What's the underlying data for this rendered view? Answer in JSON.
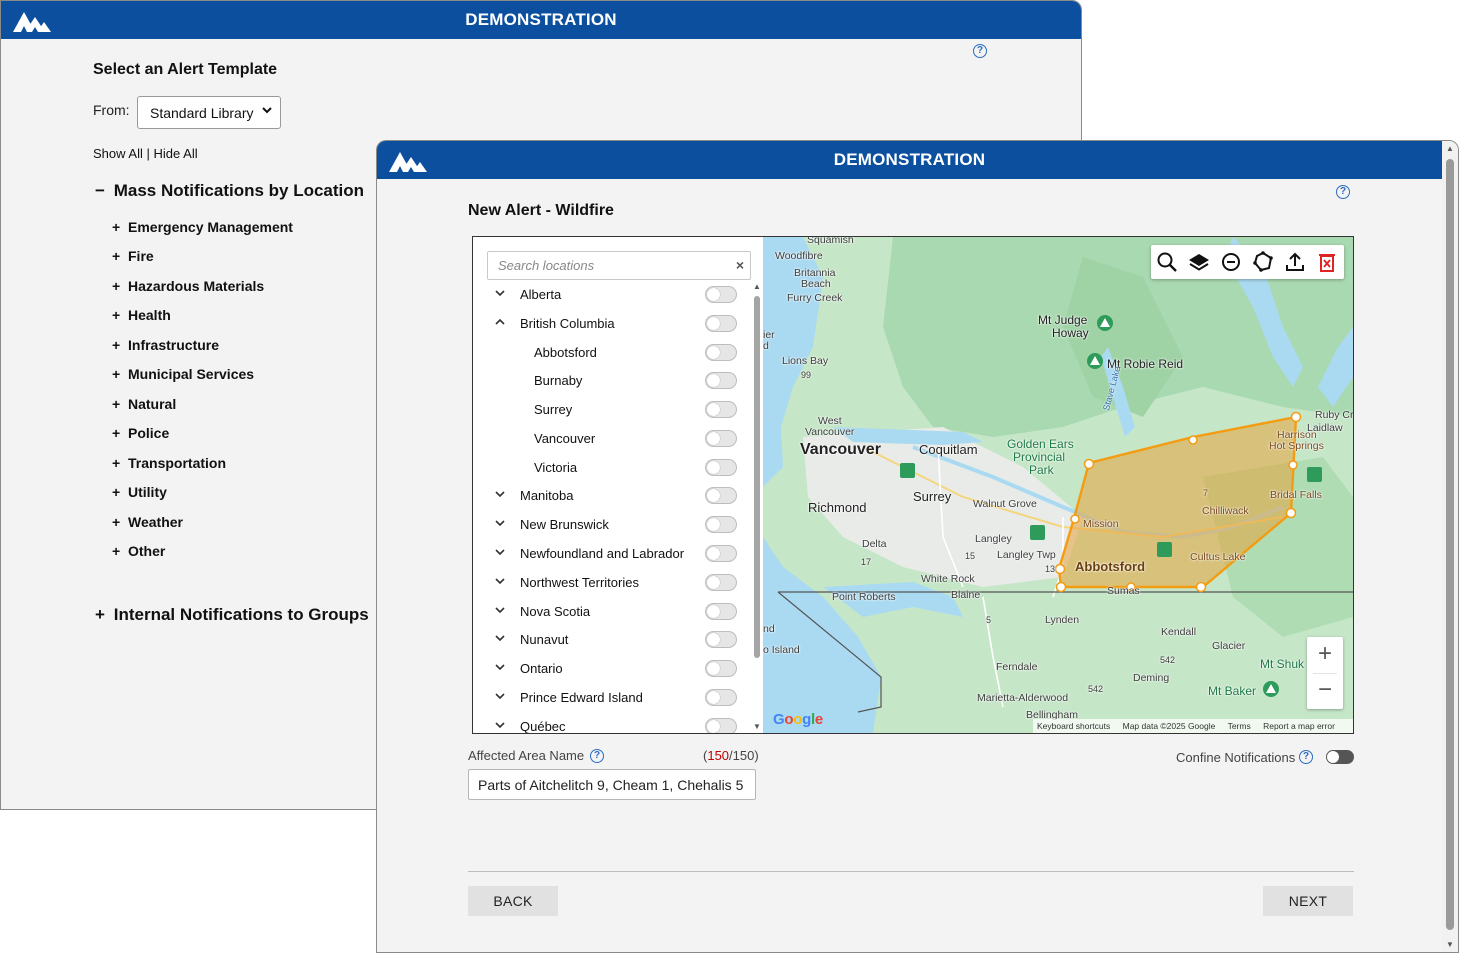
{
  "back_window": {
    "title": "DEMONSTRATION",
    "heading": "Select an Alert Template",
    "from_label": "From:",
    "from_select_value": "Standard Library",
    "show_all": "Show All",
    "hide_all": "Hide All",
    "show_hide_sep": "|",
    "sections": [
      {
        "sign": "−",
        "label": "Mass Notifications by Location"
      },
      {
        "sign": "+",
        "label": "Internal Notifications to Groups"
      }
    ],
    "categories": [
      {
        "sign": "+",
        "label": "Emergency Management"
      },
      {
        "sign": "+",
        "label": "Fire"
      },
      {
        "sign": "+",
        "label": "Hazardous Materials"
      },
      {
        "sign": "+",
        "label": "Health"
      },
      {
        "sign": "+",
        "label": "Infrastructure"
      },
      {
        "sign": "+",
        "label": "Municipal Services"
      },
      {
        "sign": "+",
        "label": "Natural"
      },
      {
        "sign": "+",
        "label": "Police"
      },
      {
        "sign": "+",
        "label": "Transportation"
      },
      {
        "sign": "+",
        "label": "Utility"
      },
      {
        "sign": "+",
        "label": "Weather"
      },
      {
        "sign": "+",
        "label": "Other"
      }
    ]
  },
  "front_window": {
    "title": "DEMONSTRATION",
    "heading": "New Alert - Wildfire",
    "search": {
      "placeholder": "Search locations",
      "clear": "×"
    },
    "locations": [
      {
        "label": "Alberta",
        "level": 0,
        "chevron": "down",
        "on": false
      },
      {
        "label": "British Columbia",
        "level": 0,
        "chevron": "up",
        "on": false
      },
      {
        "label": "Abbotsford",
        "level": 1,
        "on": false
      },
      {
        "label": "Burnaby",
        "level": 1,
        "on": false
      },
      {
        "label": "Surrey",
        "level": 1,
        "on": false
      },
      {
        "label": "Vancouver",
        "level": 1,
        "on": false
      },
      {
        "label": "Victoria",
        "level": 1,
        "on": false
      },
      {
        "label": "Manitoba",
        "level": 0,
        "chevron": "down",
        "on": false
      },
      {
        "label": "New Brunswick",
        "level": 0,
        "chevron": "down",
        "on": false
      },
      {
        "label": "Newfoundland and Labrador",
        "level": 0,
        "chevron": "down",
        "on": false
      },
      {
        "label": "Northwest Territories",
        "level": 0,
        "chevron": "down",
        "on": false
      },
      {
        "label": "Nova Scotia",
        "level": 0,
        "chevron": "down",
        "on": false
      },
      {
        "label": "Nunavut",
        "level": 0,
        "chevron": "down",
        "on": false
      },
      {
        "label": "Ontario",
        "level": 0,
        "chevron": "down",
        "on": false
      },
      {
        "label": "Prince Edward Island",
        "level": 0,
        "chevron": "down",
        "on": false
      },
      {
        "label": "Québec",
        "level": 0,
        "chevron": "down",
        "on": false
      }
    ],
    "map": {
      "tools": [
        "search-icon",
        "layers-icon",
        "circle-minus-icon",
        "polygon-icon",
        "upload-icon",
        "delete-icon"
      ],
      "zoom_in": "+",
      "zoom_out": "−",
      "polygon_color": "#f2a43a",
      "labels": {
        "squamish": "Squamish",
        "woodfibre": "Woodfibre",
        "britannia": "Britannia",
        "beach": "Beach",
        "furry_creek": "Furry Creek",
        "lions_bay": "Lions Bay",
        "west": "West",
        "west_vancouver": "Vancouver",
        "vancouver": "Vancouver",
        "coquitlam": "Coquitlam",
        "richmond": "Richmond",
        "surrey": "Surrey",
        "walnut_grove": "Walnut Grove",
        "langley": "Langley",
        "langley_twp": "Langley Twp",
        "delta": "Delta",
        "white_rock": "White Rock",
        "point_roberts": "Point Roberts",
        "blaine": "Blaine",
        "lynden": "Lynden",
        "ferndale": "Ferndale",
        "marietta": "Marietta-Alderwood",
        "bellingham": "Bellingham",
        "sumas": "Sumas",
        "kendall": "Kendall",
        "glacier": "Glacier",
        "deming": "Deming",
        "mt_judge": "Mt Judge",
        "howay": "Howay",
        "mt_robie_reid": "Mt Robie Reid",
        "stave_lake": "Stave Lake",
        "golden_ears": "Golden Ears",
        "provincial": "Provincial",
        "park": "Park",
        "mission": "Mission",
        "abbotsford": "Abbotsford",
        "chilliwack": "Chilliwack",
        "cultus_lake": "Cultus Lake",
        "bridal_falls": "Bridal Falls",
        "harrison": "Harrison",
        "hot_springs": "Hot Springs",
        "ruby_cr": "Ruby Cr",
        "laidlaw": "Laidlaw",
        "mt_shuksan": "Mt Shuk",
        "mt_baker": "Mt Baker",
        "ier": "ier",
        "d": "d",
        "nd": "nd",
        "o_island": "o Island",
        "hwy_99": "99",
        "hwy_17": "17",
        "hwy_15": "15",
        "hwy_13": "13",
        "hwy_5": "5",
        "hwy_542": "542",
        "hwy_542b": "542",
        "hwy_7": "7"
      },
      "google": "Google",
      "attribution": [
        "Keyboard shortcuts",
        "Map data ©2025 Google",
        "Terms",
        "Report a map error"
      ]
    },
    "affected_area_label": "Affected Area Name",
    "char_count_used": "150",
    "char_count_max": "/150)",
    "char_count_open": "(",
    "affected_area_value": "Parts of Aitchelitch 9, Cheam 1, Chehalis 5",
    "confine_label": "Confine Notifications",
    "confine_on": false,
    "back_button": "BACK",
    "next_button": "NEXT"
  }
}
